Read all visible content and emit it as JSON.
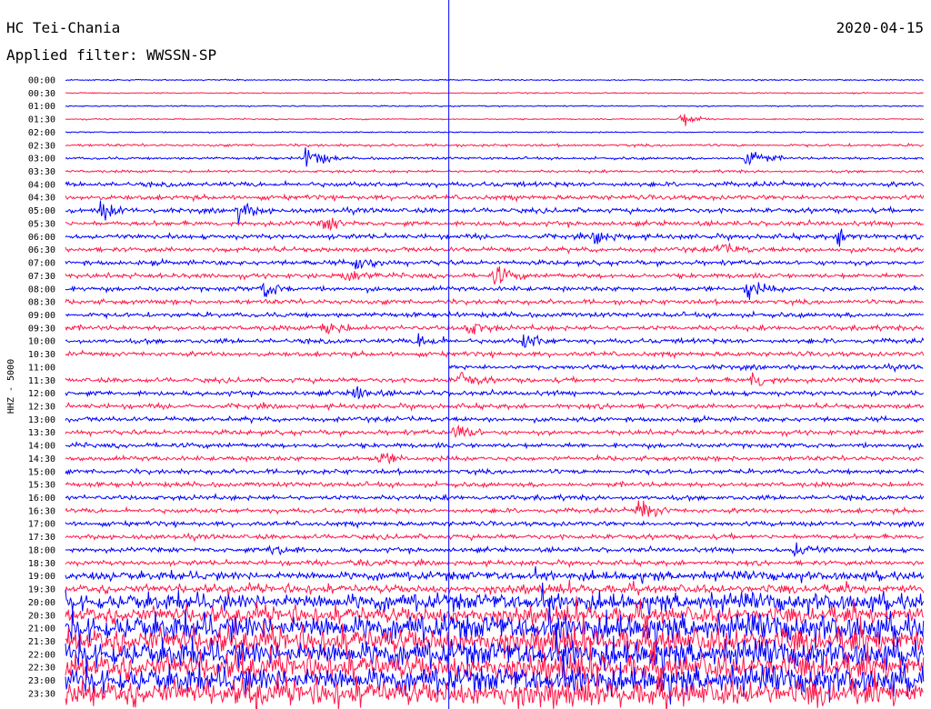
{
  "header": {
    "station": "HC Tei-Chania",
    "date": "2020-04-15",
    "filter": "Applied filter: WWSSN-SP"
  },
  "chart_data": {
    "type": "line",
    "title": "HC Tei-Chania",
    "subtitle": "Applied filter: WWSSN-SP",
    "ylabel": "HHZ - 5000",
    "row_labels": [
      "00:00",
      "00:30",
      "01:00",
      "01:30",
      "02:00",
      "02:30",
      "03:00",
      "03:30",
      "04:00",
      "04:30",
      "05:00",
      "05:30",
      "06:00",
      "06:30",
      "07:00",
      "07:30",
      "08:00",
      "08:30",
      "09:00",
      "09:30",
      "10:00",
      "10:30",
      "11:00",
      "11:30",
      "12:00",
      "12:30",
      "13:00",
      "13:30",
      "14:00",
      "14:30",
      "15:00",
      "15:30",
      "16:00",
      "16:30",
      "17:00",
      "17:30",
      "18:00",
      "18:30",
      "19:00",
      "19:30",
      "20:00",
      "20:30",
      "21:00",
      "21:30",
      "22:00",
      "22:30",
      "23:00",
      "23:30"
    ],
    "series_colors": [
      "#0000ff",
      "#ff1a4b"
    ],
    "trace_row_minutes": 30,
    "current_time": "11:00",
    "events": [
      {
        "time": "01:30",
        "minute": 21.5,
        "amplitude": 0.8
      },
      {
        "time": "03:00",
        "minute": 8.4,
        "amplitude": 1.3
      },
      {
        "time": "03:00",
        "minute": 23.8,
        "amplitude": 1.3
      },
      {
        "time": "05:00",
        "minute": 1.2,
        "amplitude": 0.9
      },
      {
        "time": "05:00",
        "minute": 6.0,
        "amplitude": 0.9
      },
      {
        "time": "05:30",
        "minute": 9.0,
        "amplitude": 0.8
      },
      {
        "time": "06:00",
        "minute": 18.5,
        "amplitude": 0.7
      },
      {
        "time": "06:00",
        "minute": 27.0,
        "amplitude": 0.7
      },
      {
        "time": "06:30",
        "minute": 22.8,
        "amplitude": 0.7
      },
      {
        "time": "07:00",
        "minute": 10.1,
        "amplitude": 0.9
      },
      {
        "time": "07:30",
        "minute": 9.8,
        "amplitude": 0.8
      },
      {
        "time": "07:30",
        "minute": 15.0,
        "amplitude": 0.9
      },
      {
        "time": "08:00",
        "minute": 6.9,
        "amplitude": 0.9
      },
      {
        "time": "08:00",
        "minute": 23.8,
        "amplitude": 0.9
      },
      {
        "time": "09:30",
        "minute": 9.0,
        "amplitude": 0.9
      },
      {
        "time": "09:30",
        "minute": 14.0,
        "amplitude": 0.9
      },
      {
        "time": "10:00",
        "minute": 12.3,
        "amplitude": 0.8
      },
      {
        "time": "10:00",
        "minute": 16.0,
        "amplitude": 0.8
      },
      {
        "time": "11:30",
        "minute": 13.7,
        "amplitude": 1.0
      },
      {
        "time": "11:30",
        "minute": 24.0,
        "amplitude": 0.9
      },
      {
        "time": "12:00",
        "minute": 10.1,
        "amplitude": 0.7
      },
      {
        "time": "13:30",
        "minute": 13.6,
        "amplitude": 1.0
      },
      {
        "time": "14:30",
        "minute": 10.9,
        "amplitude": 0.7
      },
      {
        "time": "16:30",
        "minute": 20.0,
        "amplitude": 1.1
      },
      {
        "time": "18:00",
        "minute": 7.2,
        "amplitude": 0.8
      },
      {
        "time": "18:00",
        "minute": 25.5,
        "amplitude": 0.8
      },
      {
        "time": "18:30",
        "minute": 10.0,
        "amplitude": 0.7
      }
    ]
  }
}
